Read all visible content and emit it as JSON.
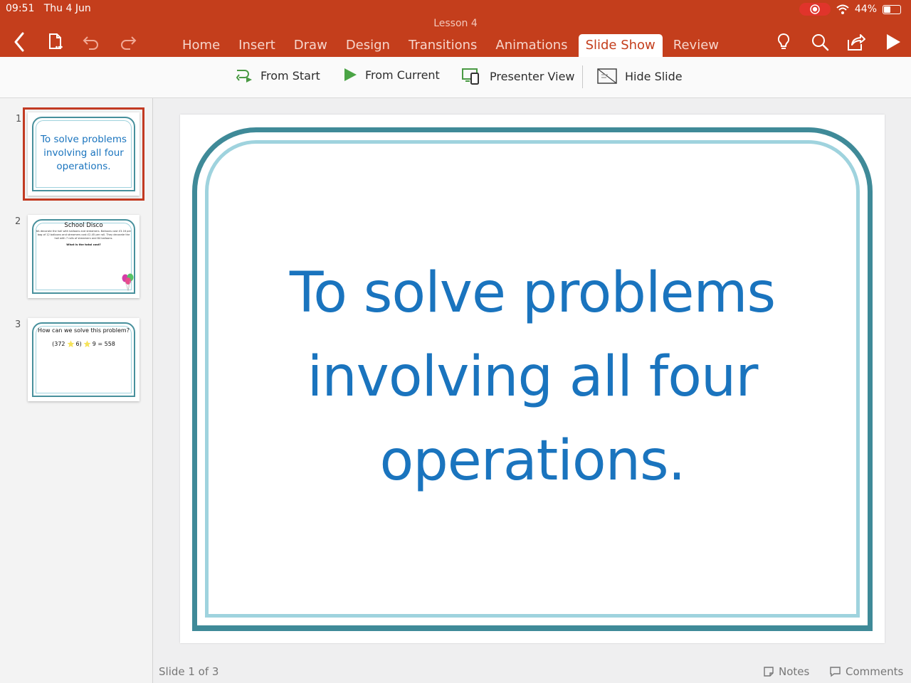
{
  "status": {
    "time": "09:51",
    "date": "Thu 4 Jun",
    "battery": "44%",
    "battery_level": 0.44
  },
  "document": {
    "title": "Lesson 4"
  },
  "tabs": [
    "Home",
    "Insert",
    "Draw",
    "Design",
    "Transitions",
    "Animations",
    "Slide Show",
    "Review"
  ],
  "active_tab": "Slide Show",
  "ribbon": {
    "from_start": "From Start",
    "from_current": "From Current",
    "presenter_view": "Presenter View",
    "hide_slide": "Hide Slide"
  },
  "thumbnails": [
    {
      "number": "1",
      "text": "To solve problems involving all four operations.",
      "selected": true
    },
    {
      "number": "2",
      "title": "School Disco",
      "body": "6A decorate the hall with balloons and streamers. Balloons cost £3.16 per bag of 12 balloons and streamers cost £2.45 per roll. They decorate the hall with 7 rolls of streamers and 84 balloons.",
      "question": "What is the total cost?"
    },
    {
      "number": "3",
      "question": "How can we solve this problem?",
      "equation_left": "(372",
      "equation_mid": "6)",
      "equation_right": "9 = 558"
    }
  ],
  "slide": {
    "title": "To solve problems involving all four operations."
  },
  "footer": {
    "slide_indicator": "Slide 1 of 3",
    "notes": "Notes",
    "comments": "Comments"
  },
  "colors": {
    "accent": "#c43e1c",
    "slide_text": "#1a74be",
    "frame_dark": "#3f8a98",
    "frame_light": "#9fd3de"
  }
}
